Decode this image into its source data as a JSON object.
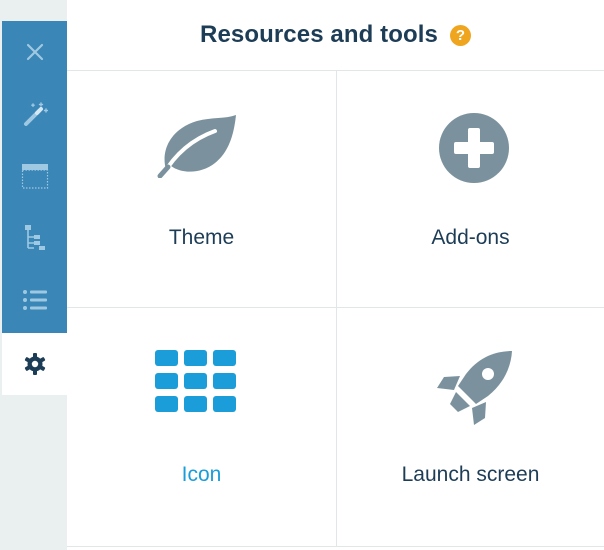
{
  "sidebar": {
    "items": [
      {
        "icon": "close-icon"
      },
      {
        "icon": "magic-wand-icon"
      },
      {
        "icon": "layout-icon"
      },
      {
        "icon": "tree-structure-icon"
      },
      {
        "icon": "list-icon"
      },
      {
        "icon": "gear-icon",
        "active": true
      }
    ]
  },
  "header": {
    "title": "Resources and tools",
    "help": "?"
  },
  "tools": [
    {
      "label": "Theme",
      "icon": "leaf-icon"
    },
    {
      "label": "Add-ons",
      "icon": "plus-circle-icon"
    },
    {
      "label": "Icon",
      "icon": "app-grid-icon",
      "highlight": true
    },
    {
      "label": "Launch screen",
      "icon": "rocket-icon"
    }
  ],
  "colors": {
    "sidebar": "#3a86b6",
    "icon_gray": "#7b929e",
    "accent": "#1a9dd9",
    "help": "#f0a51e",
    "title": "#1d3d57"
  }
}
